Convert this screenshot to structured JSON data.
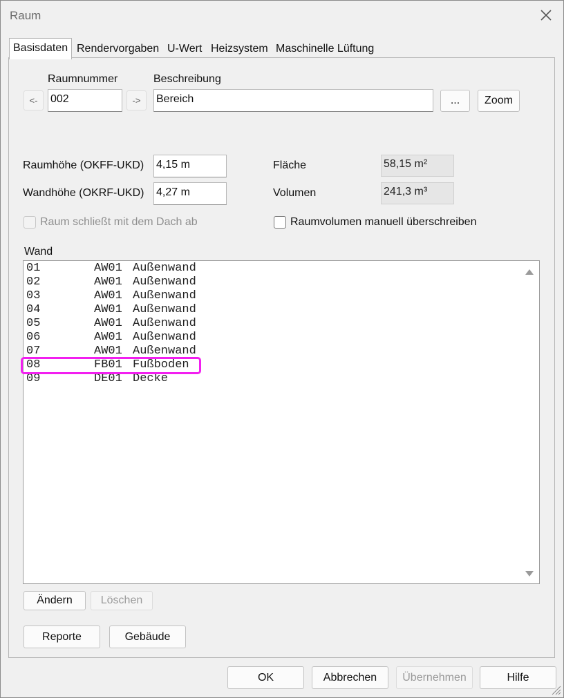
{
  "window": {
    "title": "Raum",
    "close_glyph": "✕"
  },
  "tabs": [
    {
      "label": "Basisdaten",
      "active": true
    },
    {
      "label": "Rendervorgaben"
    },
    {
      "label": "U-Wert"
    },
    {
      "label": "Heizsystem"
    },
    {
      "label": "Maschinelle Lüftung"
    }
  ],
  "room": {
    "number_label": "Raumnummer",
    "number_value": "002",
    "prev_label": "<-",
    "next_label": "->",
    "description_label": "Beschreibung",
    "description_value": "Bereich",
    "ellipsis_label": "...",
    "zoom_label": "Zoom"
  },
  "dimensions": {
    "height_label": "Raumhöhe (OKFF-UKD)",
    "height_value": "4,15 m",
    "wall_height_label": "Wandhöhe (OKRF-UKD)",
    "wall_height_value": "4,27 m",
    "area_label": "Fläche",
    "area_value": "58,15 m²",
    "volume_label": "Volumen",
    "volume_value": "241,3 m³"
  },
  "options": {
    "roof_label": "Raum schließt mit dem Dach ab",
    "roof_checked": false,
    "roof_enabled": false,
    "volume_override_label": "Raumvolumen manuell überschreiben",
    "volume_override_checked": false
  },
  "walls": {
    "label": "Wand",
    "selected_index": 7,
    "rows": [
      {
        "nr": "01",
        "code": "AW01",
        "name": "Außenwand"
      },
      {
        "nr": "02",
        "code": "AW01",
        "name": "Außenwand"
      },
      {
        "nr": "03",
        "code": "AW01",
        "name": "Außenwand"
      },
      {
        "nr": "04",
        "code": "AW01",
        "name": "Außenwand"
      },
      {
        "nr": "05",
        "code": "AW01",
        "name": "Außenwand"
      },
      {
        "nr": "06",
        "code": "AW01",
        "name": "Außenwand"
      },
      {
        "nr": "07",
        "code": "AW01",
        "name": "Außenwand"
      },
      {
        "nr": "08",
        "code": "FB01",
        "name": "Fußboden"
      },
      {
        "nr": "09",
        "code": "DE01",
        "name": "Decke"
      }
    ],
    "edit_label": "Ändern",
    "delete_label": "Löschen"
  },
  "panel_buttons": {
    "reports_label": "Reporte",
    "building_label": "Gebäude"
  },
  "footer": {
    "ok_label": "OK",
    "cancel_label": "Abbrechen",
    "apply_label": "Übernehmen",
    "help_label": "Hilfe"
  },
  "colors": {
    "highlight": "#f21ff0",
    "background": "#f0f0f0"
  }
}
